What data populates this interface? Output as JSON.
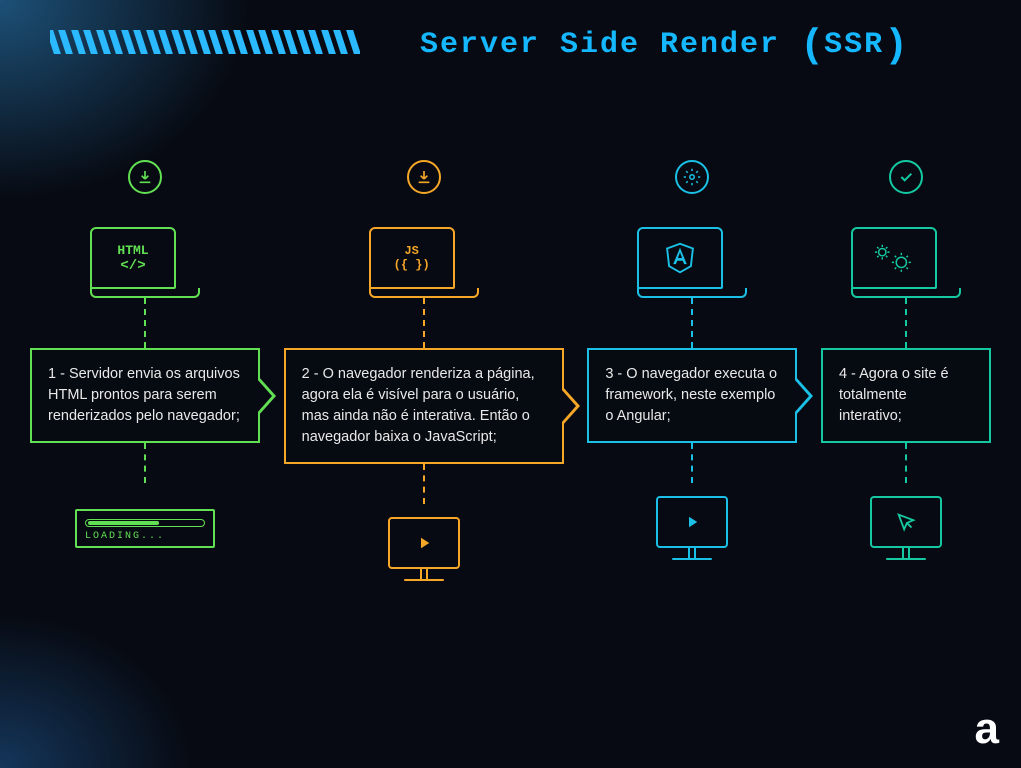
{
  "title_pre": "Server Side Render ",
  "title_acr": "SSR",
  "steps": [
    {
      "label": "HTML",
      "sub": "</>",
      "text": "1 - Servidor envia os arquivos HTML prontos para serem renderizados pelo navegador;",
      "loading": "LOADING..."
    },
    {
      "label": "JS",
      "sub": "({ })",
      "text": "2 - O navegador renderiza a página, agora ela é visível para o usuário, mas ainda não é interativa. Então o navegador baixa o JavaScript;"
    },
    {
      "text": "3 - O navegador executa o framework, neste exemplo o Angular;"
    },
    {
      "text": "4 - Agora o site é totalmente interativo;"
    }
  ],
  "watermark": "a"
}
